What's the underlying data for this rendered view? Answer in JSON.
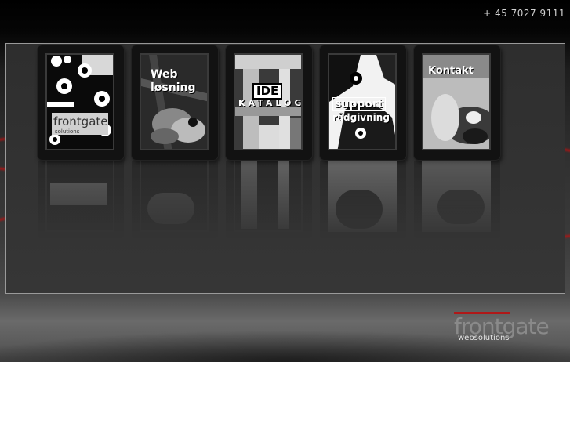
{
  "header": {
    "phone": "+ 45 7027 9111"
  },
  "tiles": [
    {
      "id": "home",
      "labels": [
        "frontgate",
        "solutions"
      ]
    },
    {
      "id": "web",
      "labels": [
        "Web",
        "løsning"
      ]
    },
    {
      "id": "ide",
      "labels": [
        "IDE",
        "KATALOG"
      ]
    },
    {
      "id": "support",
      "labels": [
        "support",
        "rådgivning"
      ]
    },
    {
      "id": "kontakt",
      "labels": [
        "Kontakt"
      ]
    }
  ],
  "footer": {
    "brand": "frontgate",
    "sub": "websolutions"
  },
  "colors": {
    "accent": "#b01818",
    "background": "#303030",
    "frame": "#9a9a9a"
  }
}
